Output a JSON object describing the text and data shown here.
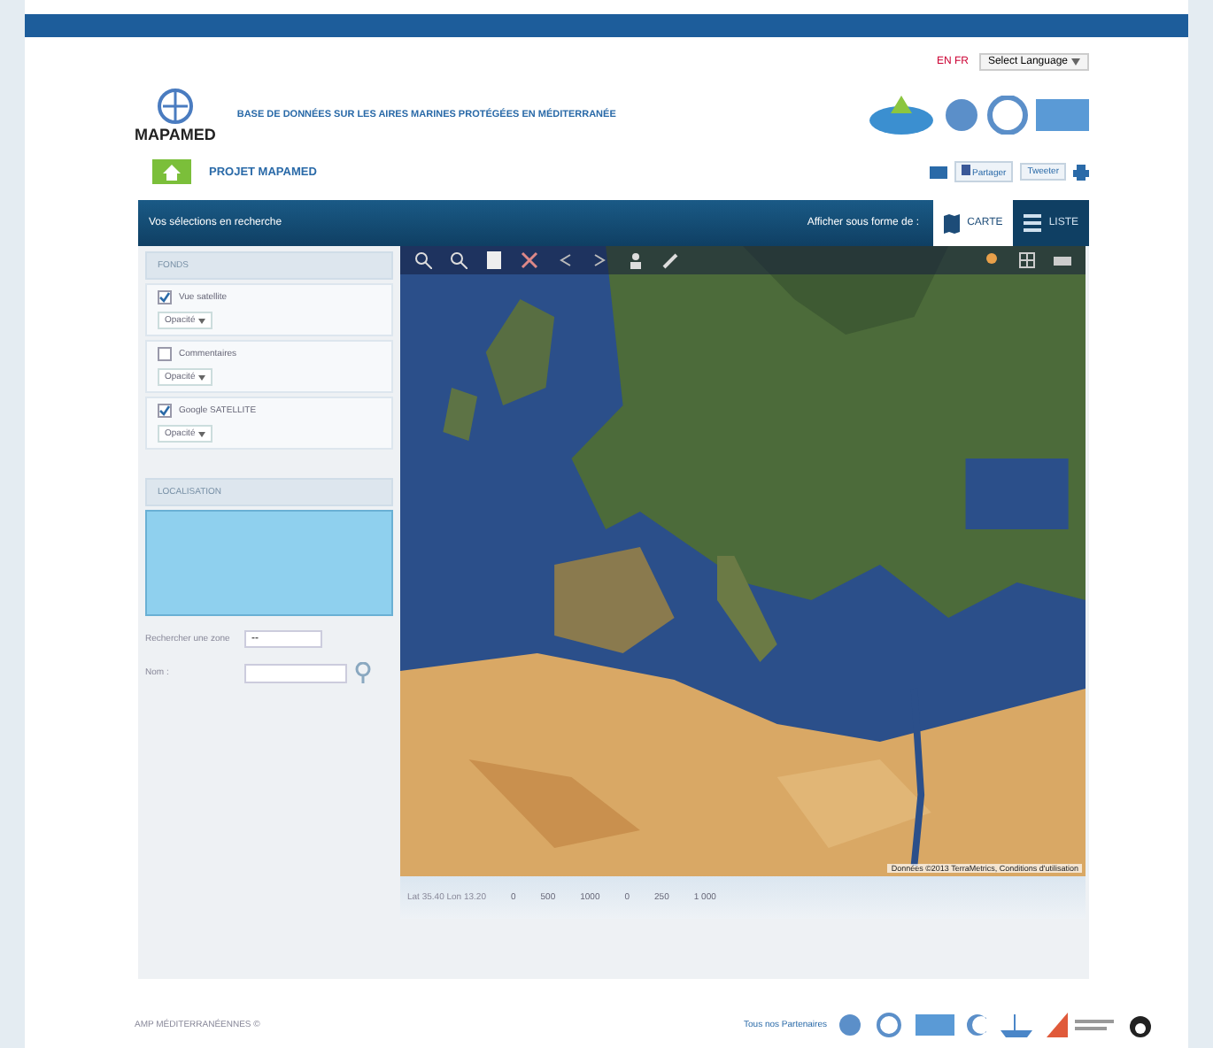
{
  "header": {
    "flags": "EN FR",
    "language": "Select Language",
    "logo": "MAPAMED",
    "tagline": "BASE DE DONNÉES SUR LES AIRES MARINES PROTÉGÉES EN MÉDITERRANÉE",
    "project": "PROJET MAPAMED",
    "share": [
      "Partager",
      "Tweeter"
    ]
  },
  "bar": {
    "title": "Vos sélections en recherche",
    "display_label": "Afficher sous forme de :",
    "views": [
      {
        "label": "CARTE",
        "selected": true
      },
      {
        "label": "LISTE",
        "selected": false
      }
    ]
  },
  "layers": {
    "title": "FONDS",
    "items": [
      {
        "label": "Vue satellite",
        "checked": true,
        "select": "Opacité"
      },
      {
        "label": "Commentaires",
        "checked": false,
        "select": "Opacité"
      },
      {
        "label": "Google SATELLITE",
        "checked": true,
        "select": "Opacité"
      }
    ]
  },
  "locate": {
    "title": "LOCALISATION",
    "zone_label": "Rechercher une zone",
    "zone_value": "--",
    "name_label": "Nom :"
  },
  "map": {
    "attribution": "Données ©2013 TerraMetrics, Conditions d'utilisation",
    "scale": {
      "label": "Lat 35.40 Lon 13.20",
      "ticks": [
        "0",
        "500",
        "1000",
        "0",
        "250",
        "1 000"
      ]
    }
  },
  "footer": {
    "copyright": "AMP MÉDITERRANÉENNES ©",
    "partners": "Tous nos Partenaires"
  }
}
